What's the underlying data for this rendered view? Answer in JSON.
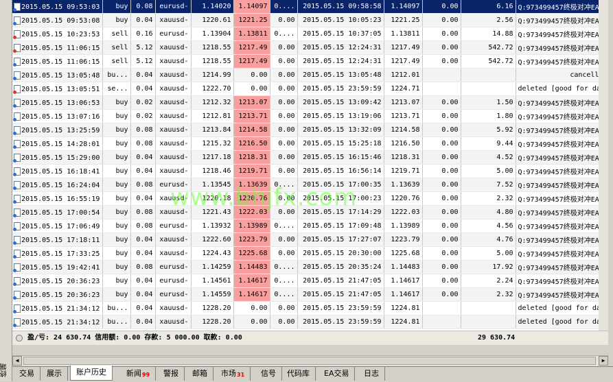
{
  "sidebar": {
    "label": "终端"
  },
  "rows": [
    {
      "selected": true,
      "dot": "blue",
      "cells": [
        "2015.05.15 09:53:03",
        "buy",
        "0.08",
        "eurusd-",
        "1.14020",
        "1.14097",
        "0....",
        "2015.05.15 09:58:58",
        "1.14097",
        "0.00",
        "6.16",
        "Q:973499457终极对冲EA..."
      ]
    },
    {
      "dot": "blue",
      "cells": [
        "2015.05.15 09:53:08",
        "buy",
        "0.04",
        "xauusd-",
        "1220.61",
        "1221.25",
        "0.00",
        "2015.05.15 10:05:23",
        "1221.25",
        "0.00",
        "2.56",
        "Q:973499457终极对冲EA..."
      ]
    },
    {
      "dot": "red",
      "cells": [
        "2015.05.15 10:23:53",
        "sell",
        "0.16",
        "eurusd-",
        "1.13904",
        "1.13811",
        "0....",
        "2015.05.15 10:37:05",
        "1.13811",
        "0.00",
        "14.88",
        "Q:973499457终极对冲EA..."
      ]
    },
    {
      "dot": "red",
      "cells": [
        "2015.05.15 11:06:15",
        "sell",
        "5.12",
        "xauusd-",
        "1218.55",
        "1217.49",
        "0.00",
        "2015.05.15 12:24:31",
        "1217.49",
        "0.00",
        "542.72",
        "Q:973499457终极对冲EA..."
      ]
    },
    {
      "dot": "blue",
      "cells": [
        "2015.05.15 11:06:15",
        "sell",
        "5.12",
        "xauusd-",
        "1218.55",
        "1217.49",
        "0.00",
        "2015.05.15 12:24:31",
        "1217.49",
        "0.00",
        "542.72",
        "Q:973499457终极对冲EA..."
      ]
    },
    {
      "dot": "blue",
      "cells": [
        "2015.05.15 13:05:48",
        "bu...",
        "0.04",
        "xauusd-",
        "1214.99",
        "0.00",
        "0.00",
        "2015.05.15 13:05:48",
        "1212.01",
        "",
        "",
        "cancelled"
      ]
    },
    {
      "dot": "red",
      "cells": [
        "2015.05.15 13:05:51",
        "se...",
        "0.04",
        "xauusd-",
        "1222.70",
        "0.00",
        "0.00",
        "2015.05.15 23:59:59",
        "1224.71",
        "",
        "",
        "deleted [good for day]"
      ]
    },
    {
      "dot": "blue",
      "cells": [
        "2015.05.15 13:06:53",
        "buy",
        "0.02",
        "xauusd-",
        "1212.32",
        "1213.07",
        "0.00",
        "2015.05.15 13:09:42",
        "1213.07",
        "0.00",
        "1.50",
        "Q:973499457终极对冲EA..."
      ]
    },
    {
      "dot": "blue",
      "cells": [
        "2015.05.15 13:07:16",
        "buy",
        "0.02",
        "xauusd-",
        "1212.81",
        "1213.71",
        "0.00",
        "2015.05.15 13:19:06",
        "1213.71",
        "0.00",
        "1.80",
        "Q:973499457终极对冲EA..."
      ]
    },
    {
      "dot": "blue",
      "cells": [
        "2015.05.15 13:25:59",
        "buy",
        "0.08",
        "xauusd-",
        "1213.84",
        "1214.58",
        "0.00",
        "2015.05.15 13:32:09",
        "1214.58",
        "0.00",
        "5.92",
        "Q:973499457终极对冲EA..."
      ]
    },
    {
      "dot": "blue",
      "cells": [
        "2015.05.15 14:28:01",
        "buy",
        "0.08",
        "xauusd-",
        "1215.32",
        "1216.50",
        "0.00",
        "2015.05.15 15:25:18",
        "1216.50",
        "0.00",
        "9.44",
        "Q:973499457终极对冲EA..."
      ]
    },
    {
      "dot": "blue",
      "cells": [
        "2015.05.15 15:29:00",
        "buy",
        "0.04",
        "xauusd-",
        "1217.18",
        "1218.31",
        "0.00",
        "2015.05.15 16:15:46",
        "1218.31",
        "0.00",
        "4.52",
        "Q:973499457终极对冲EA..."
      ]
    },
    {
      "dot": "blue",
      "cells": [
        "2015.05.15 16:18:41",
        "buy",
        "0.04",
        "xauusd-",
        "1218.46",
        "1219.71",
        "0.00",
        "2015.05.15 16:56:14",
        "1219.71",
        "0.00",
        "5.00",
        "Q:973499457终极对冲EA..."
      ]
    },
    {
      "dot": "blue",
      "cells": [
        "2015.05.15 16:24:04",
        "buy",
        "0.08",
        "eurusd-",
        "1.13545",
        "1.13639",
        "0....",
        "2015.05.15 17:00:35",
        "1.13639",
        "0.00",
        "7.52",
        "Q:973499457终极对冲EA..."
      ]
    },
    {
      "dot": "blue",
      "cells": [
        "2015.05.15 16:55:19",
        "buy",
        "0.04",
        "xauusd-",
        "1220.18",
        "1220.76",
        "0.00",
        "2015.05.15 17:00:23",
        "1220.76",
        "0.00",
        "2.32",
        "Q:973499457终极对冲EA..."
      ]
    },
    {
      "dot": "blue",
      "cells": [
        "2015.05.15 17:00:54",
        "buy",
        "0.08",
        "xauusd-",
        "1221.43",
        "1222.03",
        "0.00",
        "2015.05.15 17:14:29",
        "1222.03",
        "0.00",
        "4.80",
        "Q:973499457终极对冲EA..."
      ]
    },
    {
      "dot": "blue",
      "cells": [
        "2015.05.15 17:06:49",
        "buy",
        "0.08",
        "eurusd-",
        "1.13932",
        "1.13989",
        "0....",
        "2015.05.15 17:09:48",
        "1.13989",
        "0.00",
        "4.56",
        "Q:973499457终极对冲EA..."
      ]
    },
    {
      "dot": "blue",
      "cells": [
        "2015.05.15 17:18:11",
        "buy",
        "0.04",
        "xauusd-",
        "1222.60",
        "1223.79",
        "0.00",
        "2015.05.15 17:27:07",
        "1223.79",
        "0.00",
        "4.76",
        "Q:973499457终极对冲EA..."
      ]
    },
    {
      "dot": "blue",
      "cells": [
        "2015.05.15 17:33:25",
        "buy",
        "0.04",
        "xauusd-",
        "1224.43",
        "1225.68",
        "0.00",
        "2015.05.15 20:30:00",
        "1225.68",
        "0.00",
        "5.00",
        "Q:973499457终极对冲EA..."
      ]
    },
    {
      "dot": "blue",
      "cells": [
        "2015.05.15 19:42:41",
        "buy",
        "0.08",
        "eurusd-",
        "1.14259",
        "1.14483",
        "0....",
        "2015.05.15 20:35:24",
        "1.14483",
        "0.00",
        "17.92",
        "Q:973499457终极对冲EA..."
      ]
    },
    {
      "dot": "blue",
      "cells": [
        "2015.05.15 20:36:23",
        "buy",
        "0.04",
        "eurusd-",
        "1.14561",
        "1.14617",
        "0....",
        "2015.05.15 21:47:05",
        "1.14617",
        "0.00",
        "2.24",
        "Q:973499457终极对冲EA..."
      ]
    },
    {
      "dot": "blue",
      "cells": [
        "2015.05.15 20:36:23",
        "buy",
        "0.04",
        "eurusd-",
        "1.14559",
        "1.14617",
        "0....",
        "2015.05.15 21:47:05",
        "1.14617",
        "0.00",
        "2.32",
        "Q:973499457终极对冲EA..."
      ]
    },
    {
      "dot": "blue",
      "cells": [
        "2015.05.15 21:34:12",
        "bu...",
        "0.04",
        "xauusd-",
        "1228.20",
        "0.00",
        "0.00",
        "2015.05.15 23:59:59",
        "1224.81",
        "",
        "",
        "deleted [good for day]"
      ]
    },
    {
      "dot": "blue",
      "cells": [
        "2015.05.15 21:34:12",
        "bu...",
        "0.04",
        "xauusd-",
        "1228.20",
        "0.00",
        "0.00",
        "2015.05.15 23:59:59",
        "1224.81",
        "",
        "",
        "deleted [good for day]"
      ]
    }
  ],
  "summary": {
    "text": "盈/亏: 24 630.74  信用额: 0.00  存款: 5 000.00  取款: 0.00",
    "total": "29 630.74"
  },
  "tabs": [
    {
      "label": "交易",
      "name": "tab-trade"
    },
    {
      "label": "展示",
      "name": "tab-exposure"
    },
    {
      "label": "账户历史",
      "name": "tab-account-history",
      "active": true
    },
    {
      "label": "新闻",
      "name": "tab-news",
      "badge": "99"
    },
    {
      "label": "警报",
      "name": "tab-alerts"
    },
    {
      "label": "邮箱",
      "name": "tab-mailbox"
    },
    {
      "label": "市场",
      "name": "tab-market",
      "badge": "31"
    },
    {
      "label": "信号",
      "name": "tab-signals"
    },
    {
      "label": "代码库",
      "name": "tab-code-base"
    },
    {
      "label": "EA交易",
      "name": "tab-experts"
    },
    {
      "label": "日志",
      "name": "tab-journal"
    }
  ],
  "watermark": "www.bhjfx.com",
  "colors": {
    "selected_row": "#0a246a",
    "highlight_cell": "#f8a0a0",
    "buy_dot": "#2f6fd0",
    "sell_dot": "#d23c1c"
  }
}
